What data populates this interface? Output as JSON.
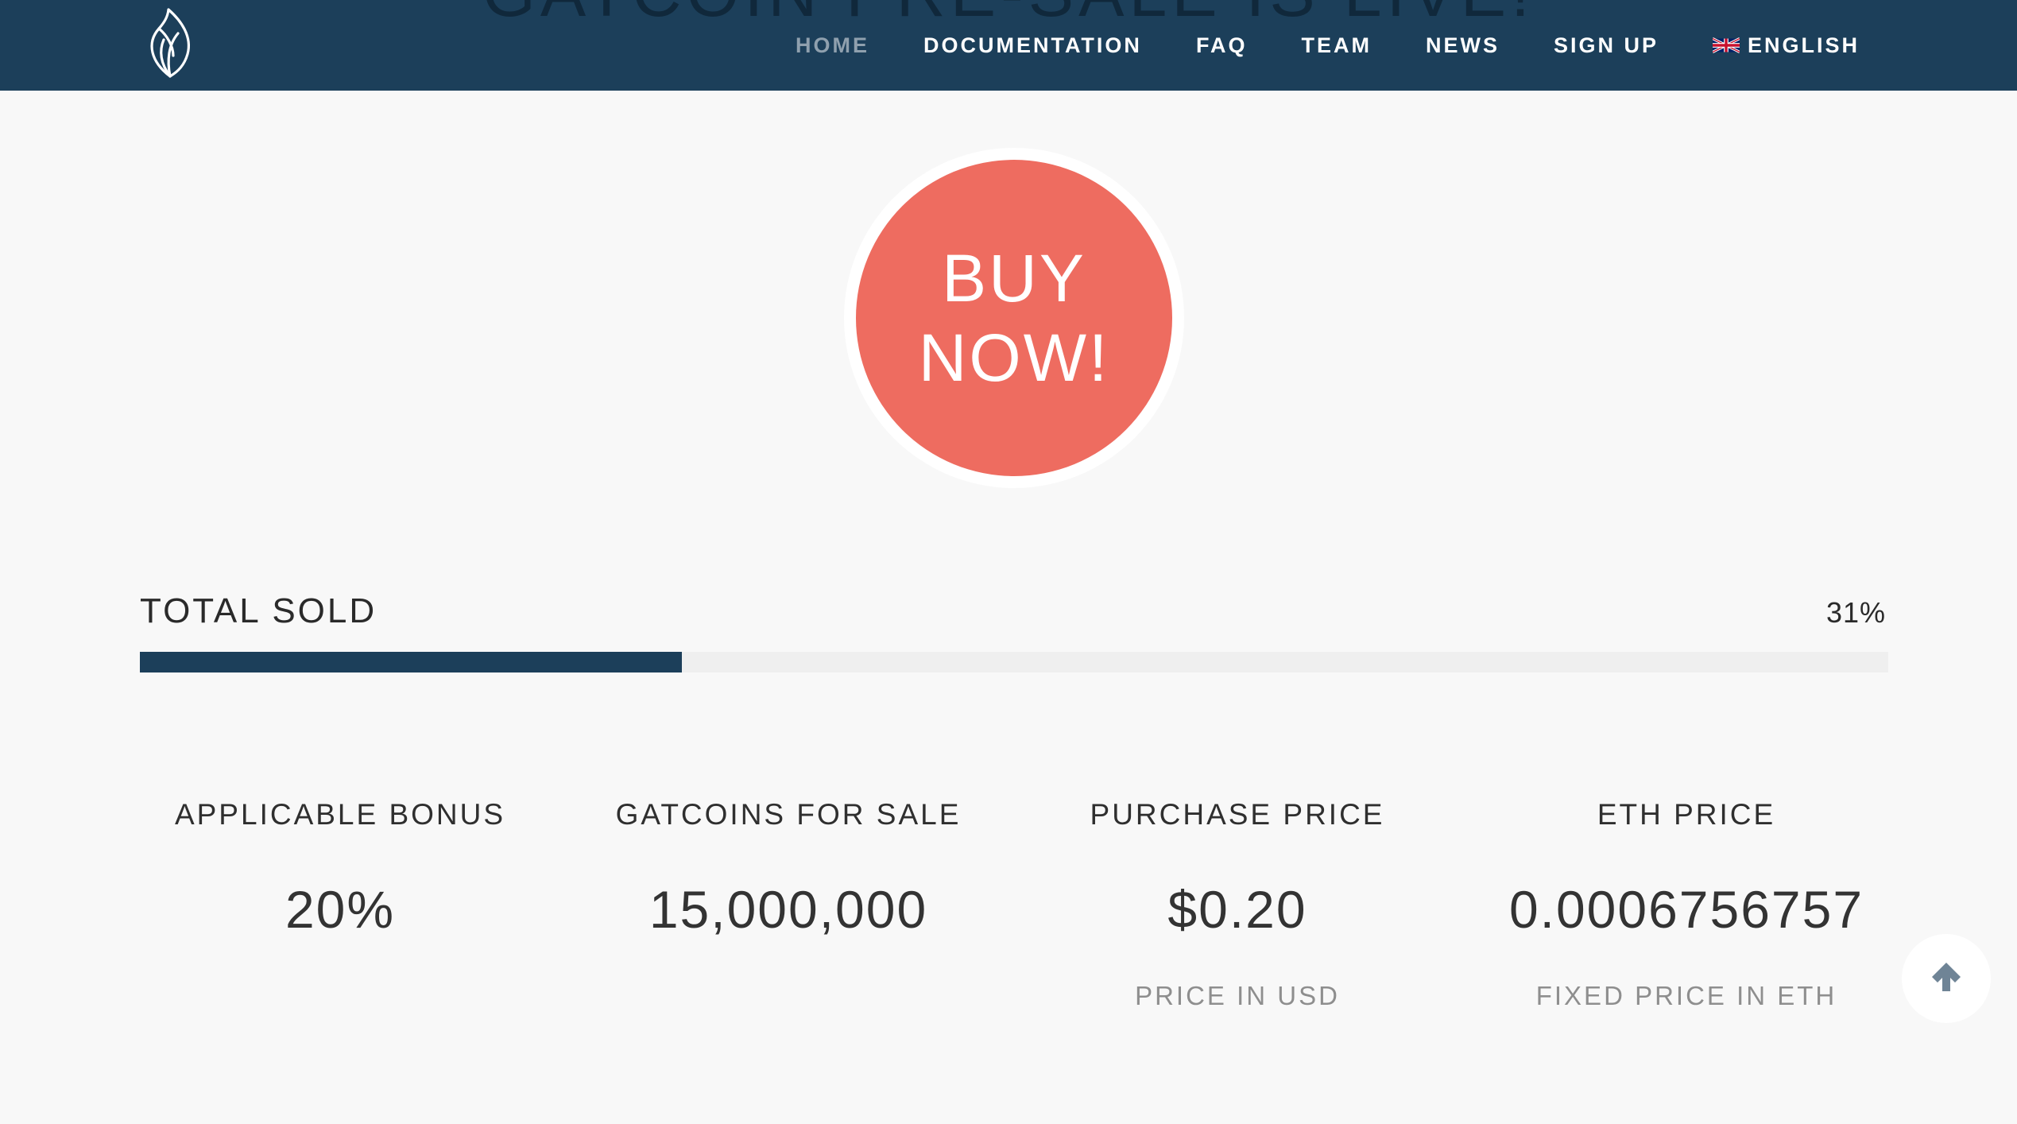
{
  "header": {
    "ghost_title": "GATCOIN PRE-SALE IS LIVE!",
    "nav": {
      "home": "HOME",
      "documentation": "DOCUMENTATION",
      "faq": "FAQ",
      "team": "TEAM",
      "news": "NEWS",
      "signup": "SIGN UP",
      "language": "ENGLISH"
    },
    "icons": {
      "logo": "leaf-logo-icon",
      "flag": "uk-flag-icon"
    }
  },
  "buy": {
    "line1": "BUY",
    "line2": "NOW!"
  },
  "progress": {
    "label": "TOTAL SOLD",
    "percent_text": "31%",
    "percent": 31
  },
  "stats": {
    "bonus": {
      "label": "APPLICABLE BONUS",
      "value": "20%"
    },
    "for_sale": {
      "label": "GATCOINS FOR SALE",
      "value": "15,000,000"
    },
    "purchase_price": {
      "label": "PURCHASE PRICE",
      "value": "$0.20",
      "sub": "PRICE IN USD"
    },
    "eth_price": {
      "label": "ETH PRICE",
      "value": "0.0006756757",
      "sub": "FIXED PRICE IN ETH"
    }
  },
  "colors": {
    "header_bg": "#1c3f5a",
    "buy_button": "#ee6c60",
    "progress_fill": "#1c3f5a",
    "progress_track": "#efefef",
    "page_bg": "#f8f8f8"
  },
  "scroll_top": {
    "icon": "arrow-up-icon"
  }
}
